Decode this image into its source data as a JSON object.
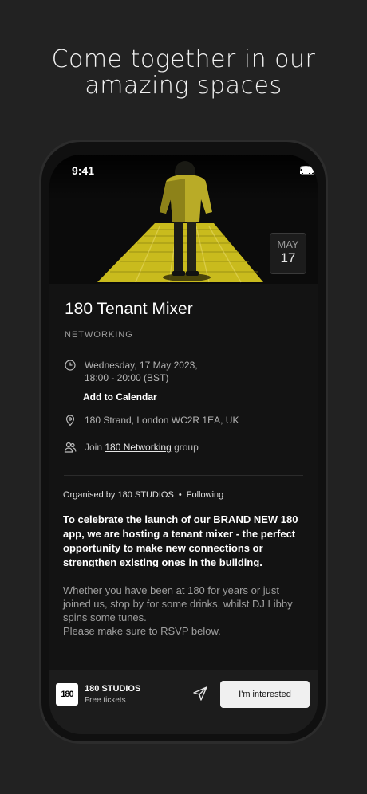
{
  "headline": [
    "Come together in our",
    "amazing spaces"
  ],
  "status": {
    "time": "9:41"
  },
  "date_badge": {
    "month": "MAY",
    "day": "17"
  },
  "event": {
    "title": "180 Tenant Mixer",
    "category": "NETWORKING",
    "date_line1": "Wednesday, 17 May 2023,",
    "date_line2": "18:00 - 20:00 (BST)",
    "add_to_calendar": "Add to Calendar",
    "location": "180 Strand, London WC2R 1EA, UK",
    "join_prefix": "Join ",
    "join_link": "180 Networking",
    "join_suffix": " group"
  },
  "organiser": {
    "text": "Organised by 180 STUDIOS",
    "dot": "•",
    "following": "Following"
  },
  "description": {
    "bold": "To celebrate the launch of our BRAND NEW 180 app, we are hosting a tenant mixer - the perfect opportunity to make new connections or strengthen existing ones in the building.",
    "line1": "Whether you have been at 180 for years or just joined us, stop by for some drinks, whilst DJ Libby spins some tunes.",
    "line2": "Please make sure to RSVP below."
  },
  "bottom_bar": {
    "logo_text": "180",
    "org_name": "180 STUDIOS",
    "ticket_info": "Free tickets",
    "cta_label": "I'm interested"
  },
  "colors": {
    "accent_yellow": "#d8c81e",
    "background": "#222222",
    "screen": "#131313"
  }
}
